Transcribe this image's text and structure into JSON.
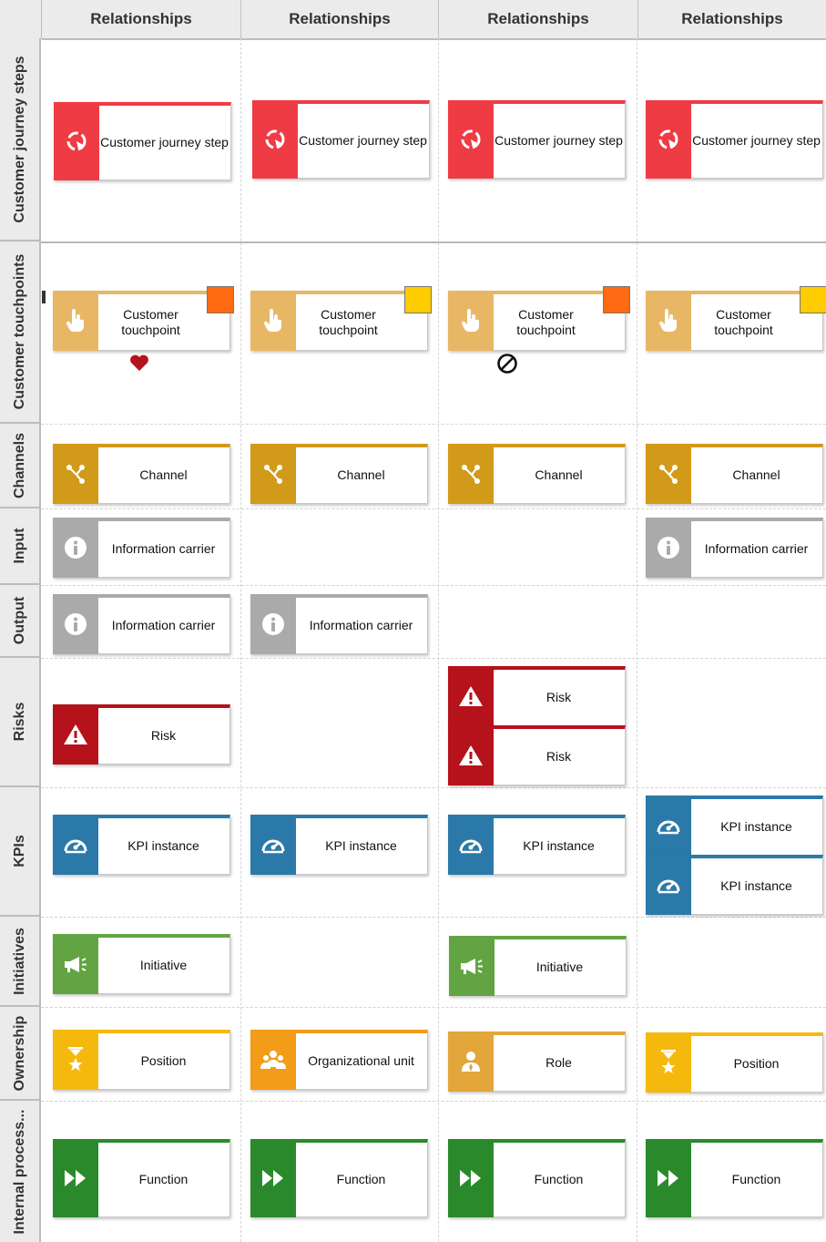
{
  "columns": [
    "Relationships",
    "Relationships",
    "Relationships",
    "Relationships"
  ],
  "rows": [
    "Customer journey steps",
    "Customer touchpoints",
    "Channels",
    "Input",
    "Output",
    "Risks",
    "KPIs",
    "Initiatives",
    "Ownership",
    "Internal process..."
  ],
  "objects": {
    "customer_journey_step": "Customer journey step",
    "customer_touchpoint": "Customer touchpoint",
    "channel": "Channel",
    "information_carrier": "Information carrier",
    "risk": "Risk",
    "kpi_instance": "KPI instance",
    "initiative": "Initiative",
    "position": "Position",
    "organizational_unit": "Organizational unit",
    "role": "Role",
    "function": "Function"
  },
  "touchpoint_status_colors": [
    "#ff6a13",
    "#ffcc00",
    "#ff6a13",
    "#ffcc00"
  ],
  "colors": {
    "customer_journey_step": "#ef3b44",
    "customer_touchpoint": "#e8b766",
    "channel": "#d19a18",
    "information_carrier": "#aaaaaa",
    "risk": "#b5121b",
    "kpi_instance": "#2b79a8",
    "initiative": "#62a443",
    "position": "#f5b90e",
    "organizational_unit": "#f29c17",
    "role": "#e3a63b",
    "function": "#2a8a2b",
    "heart": "#b5121b"
  },
  "icons": {
    "customer_journey_step": "cycle-icon",
    "customer_touchpoint": "hand-pointer-icon",
    "channel": "network-icon",
    "information_carrier": "info-icon",
    "risk": "warning-icon",
    "kpi_instance": "gauge-icon",
    "initiative": "megaphone-icon",
    "position": "hourglass-star-icon",
    "organizational_unit": "people-group-icon",
    "role": "person-icon",
    "function": "fast-forward-icon",
    "heart": "heart-icon",
    "prohibited": "prohibited-icon"
  }
}
